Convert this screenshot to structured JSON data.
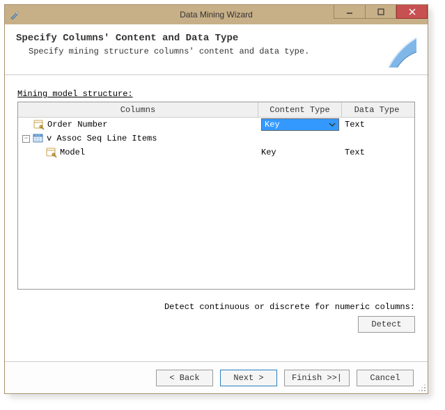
{
  "window": {
    "title": "Data Mining Wizard"
  },
  "header": {
    "title": "Specify Columns' Content and Data Type",
    "subtitle": "Specify mining structure columns' content and data type."
  },
  "body": {
    "section_label": "Mining model structure:",
    "columns": {
      "c1": "Columns",
      "c2": "Content Type",
      "c3": "Data Type"
    },
    "rows": [
      {
        "indent": 0,
        "expander": null,
        "icon": "key",
        "label": "Order Number",
        "contentType": "Key",
        "contentTypeEditing": true,
        "dataType": "Text"
      },
      {
        "indent": 0,
        "expander": "minus",
        "icon": "table",
        "label": "v Assoc Seq Line Items",
        "contentType": "",
        "contentTypeEditing": false,
        "dataType": ""
      },
      {
        "indent": 1,
        "expander": null,
        "icon": "key",
        "label": "Model",
        "contentType": "Key",
        "contentTypeEditing": false,
        "dataType": "Text"
      }
    ],
    "detect_hint": "Detect continuous or discrete for numeric columns:",
    "detect_label": "Detect"
  },
  "footer": {
    "back": "< Back",
    "next": "Next >",
    "finish": "Finish >>|",
    "cancel": "Cancel"
  }
}
